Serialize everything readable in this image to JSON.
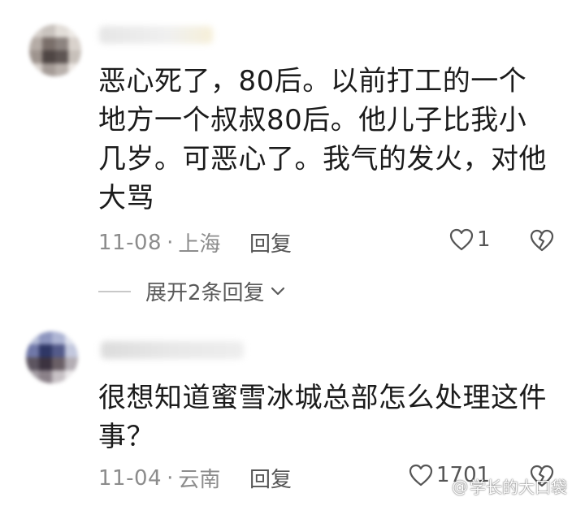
{
  "comments": [
    {
      "text": "恶心死了，80后。以前打工的一个地方一个叔叔80后。他儿子比我小几岁。可恶心了。我气的发火，对他大骂",
      "date": "11-08",
      "separator": "·",
      "location": "上海",
      "reply_label": "回复",
      "like_count": "1"
    },
    {
      "text": "很想知道蜜雪冰城总部怎么处理这件事？",
      "date": "11-04",
      "separator": "·",
      "location": "云南",
      "reply_label": "回复",
      "like_count": "1701"
    }
  ],
  "expand_replies_label": "展开2条回复",
  "watermark": {
    "at_symbol": "@",
    "text": "学长的大口袋"
  },
  "icons": {
    "like": "heart-outline-icon",
    "dislike": "broken-heart-icon",
    "expand": "chevron-down-icon"
  },
  "colors": {
    "text": "#1b1b1b",
    "meta": "#8c8c8c",
    "action": "#555555"
  }
}
